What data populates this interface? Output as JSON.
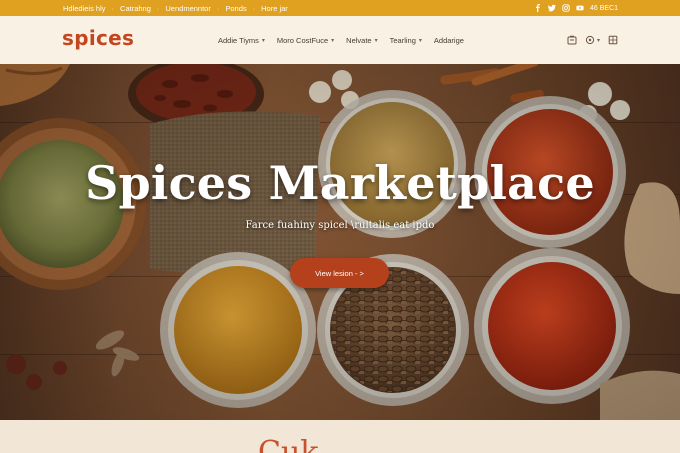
{
  "topbar": {
    "links": [
      "Hdledieis hly",
      "Catrahng",
      "Uendmenntor",
      "Ponds",
      "Hore jar"
    ],
    "separator": "·",
    "language": "46 BEC1",
    "social_icons": [
      "facebook-icon",
      "twitter-icon",
      "instagram-icon",
      "youtube-icon"
    ]
  },
  "header": {
    "logo": "spices",
    "nav": [
      {
        "label": "Addie Tiyms",
        "has_caret": true
      },
      {
        "label": "Moro CostFuce",
        "has_caret": true
      },
      {
        "label": "Nelvate",
        "has_caret": true
      },
      {
        "label": "Tearling",
        "has_caret": true
      },
      {
        "label": "Addarige",
        "has_caret": false
      }
    ],
    "icons": [
      "account-icon",
      "user-icon",
      "cart-icon"
    ]
  },
  "hero": {
    "title": "Spices  Marketplace",
    "subtitle": "Farce fuahiny spicel \\rultalis eat ipdo",
    "button_label": "View lesion - >"
  },
  "section": {
    "title": "Cuk"
  },
  "colors": {
    "topbar": "#e0a020",
    "accent": "#c4461e",
    "button": "#b5401c",
    "header_bg": "#f8f1e4"
  }
}
